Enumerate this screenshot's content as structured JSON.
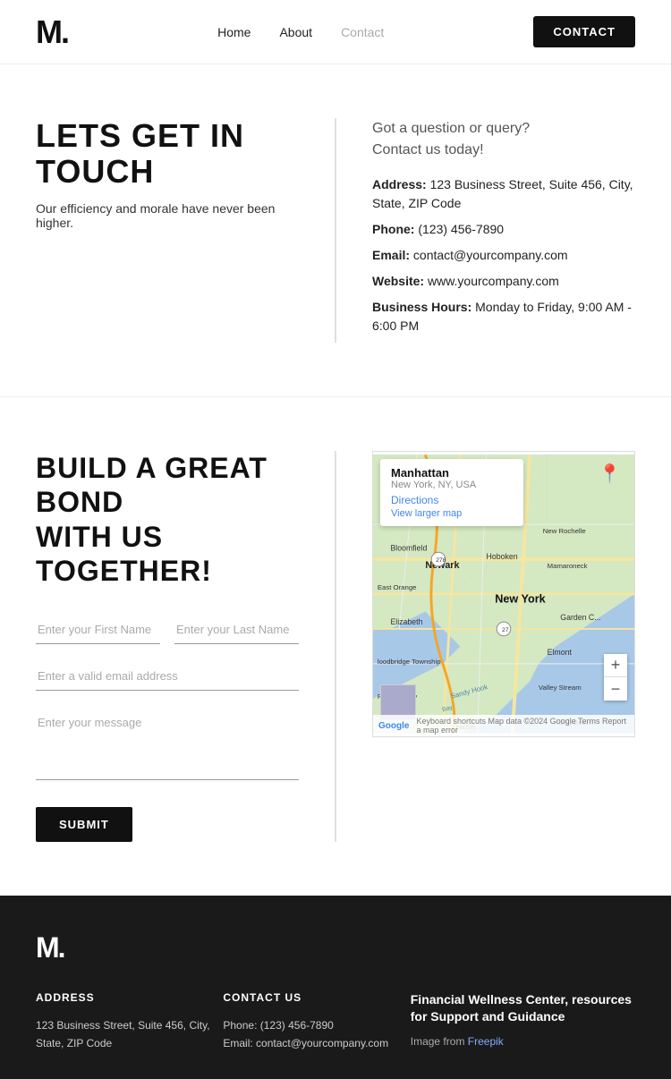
{
  "nav": {
    "logo": "M.",
    "links": [
      {
        "label": "Home",
        "href": "#",
        "active": false
      },
      {
        "label": "About",
        "href": "#",
        "active": false
      },
      {
        "label": "Contact",
        "href": "#",
        "active": true
      }
    ],
    "contact_button": "CONTACT"
  },
  "section1": {
    "title": "LETS GET IN TOUCH",
    "subtitle": "Our efficiency and morale have never been higher.",
    "query_line1": "Got a question or query?",
    "query_line2": "Contact us today!",
    "address_label": "Address:",
    "address_value": "123 Business Street, Suite 456, City, State, ZIP Code",
    "phone_label": "Phone:",
    "phone_value": "(123) 456-7890",
    "email_label": "Email:",
    "email_value": "contact@yourcompany.com",
    "website_label": "Website:",
    "website_value": "www.yourcompany.com",
    "hours_label": "Business Hours:",
    "hours_value": "Monday to Friday, 9:00 AM - 6:00 PM"
  },
  "section2": {
    "title_line1": "BUILD A GREAT BOND",
    "title_line2": "WITH US TOGETHER!",
    "first_name_placeholder": "Enter your First Name",
    "last_name_placeholder": "Enter your Last Name",
    "email_placeholder": "Enter a valid email address",
    "message_placeholder": "Enter your message",
    "submit_label": "SUBMIT"
  },
  "map": {
    "location_name": "Manhattan",
    "location_sub": "New York, NY, USA",
    "directions_label": "Directions",
    "view_larger": "View larger map",
    "zoom_in": "+",
    "zoom_out": "−",
    "footer_text": "Keyboard shortcuts  Map data ©2024 Google  Terms  Report a map error"
  },
  "footer": {
    "logo": "M.",
    "address_title": "ADDRESS",
    "address_line1": "123 Business Street, Suite 456, City,",
    "address_line2": "State, ZIP Code",
    "contact_title": "CONTACT US",
    "phone": "Phone: (123) 456-7890",
    "email": "Email: contact@yourcompany.com",
    "financial_title": "Financial Wellness Center, resources for Support and Guidance",
    "image_from": "Image from",
    "freepik_label": "Freepik",
    "freepik_href": "#"
  }
}
